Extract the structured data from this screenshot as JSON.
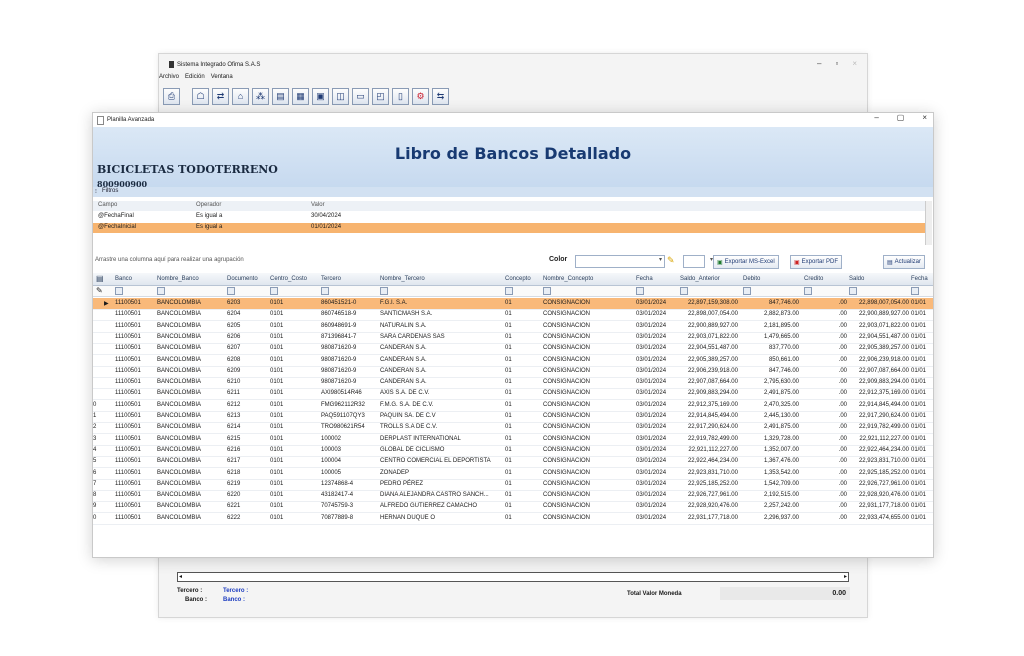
{
  "bg_window": {
    "title": "Sistema Integrado Ofima S.A.S",
    "menu": [
      "Archivo",
      "Edición",
      "Ventana"
    ],
    "tercero_label": "Tercero :",
    "tercero_value": "Tercero :",
    "banco_label": "Banco :",
    "banco_value": "Banco :",
    "total_label": "Total Valor Moneda",
    "total_value": "0.00"
  },
  "main": {
    "window_title": "Planilla Avanzada",
    "report_title": "Libro de Bancos Detallado",
    "company": "BICICLETAS TODOTERRENO",
    "nit": "800900900",
    "filters_label": "Filtros",
    "filter_headers": {
      "campo": "Campo",
      "operador": "Operador",
      "valor": "Valor"
    },
    "filters": [
      {
        "campo": "@FechaFinal",
        "operador": "Es igual a",
        "valor": "30/04/2024"
      },
      {
        "campo": "@FechaInicial",
        "operador": "Es igual a",
        "valor": "01/01/2024"
      }
    ],
    "group_hint": "Arrastre una columna aquí para realizar una agrupación",
    "color_label": "Color",
    "export_excel": "Exportar MS-Excel",
    "export_pdf": "Exportar PDF",
    "refresh": "Actualizar"
  },
  "table": {
    "columns": [
      "Banco",
      "Nombre_Banco",
      "Documento",
      "Centro_Costo",
      "Tercero",
      "Nombre_Tercero",
      "Concepto",
      "Nombre_Concepto",
      "Fecha",
      "Saldo_Anterior",
      "Debito",
      "Credito",
      "Saldo",
      "Fecha"
    ],
    "rows": [
      {
        "n": "",
        "banco": "11100501",
        "nb": "BANCOLOMBIA",
        "doc": "6203",
        "cc": "0101",
        "ter": "860451521-0",
        "nt": "F.G.I. S.A.",
        "con": "01",
        "nc": "CONSIGNACION",
        "fecha": "03/01/2024",
        "sa": "22,897,159,308.00",
        "deb": "847,746.00",
        "cre": ".00",
        "saldo": "22,898,007,054.00",
        "f2": "01/01"
      },
      {
        "n": "",
        "banco": "11100501",
        "nb": "BANCOLOMBIA",
        "doc": "6204",
        "cc": "0101",
        "ter": "860746518-9",
        "nt": "SANTICMASH S.A.",
        "con": "01",
        "nc": "CONSIGNACION",
        "fecha": "03/01/2024",
        "sa": "22,898,007,054.00",
        "deb": "2,882,873.00",
        "cre": ".00",
        "saldo": "22,900,889,927.00",
        "f2": "01/01"
      },
      {
        "n": "",
        "banco": "11100501",
        "nb": "BANCOLOMBIA",
        "doc": "6205",
        "cc": "0101",
        "ter": "860948691-9",
        "nt": "NATURALIN S.A.",
        "con": "01",
        "nc": "CONSIGNACION",
        "fecha": "03/01/2024",
        "sa": "22,900,889,927.00",
        "deb": "2,181,895.00",
        "cre": ".00",
        "saldo": "22,903,071,822.00",
        "f2": "01/01"
      },
      {
        "n": "",
        "banco": "11100501",
        "nb": "BANCOLOMBIA",
        "doc": "6206",
        "cc": "0101",
        "ter": "871396841-7",
        "nt": "SARA CARDENAS SAS",
        "con": "01",
        "nc": "CONSIGNACION",
        "fecha": "03/01/2024",
        "sa": "22,903,071,822.00",
        "deb": "1,479,665.00",
        "cre": ".00",
        "saldo": "22,904,551,487.00",
        "f2": "01/01"
      },
      {
        "n": "",
        "banco": "11100501",
        "nb": "BANCOLOMBIA",
        "doc": "6207",
        "cc": "0101",
        "ter": "980871620-9",
        "nt": "CANDERAN S.A.",
        "con": "01",
        "nc": "CONSIGNACION",
        "fecha": "03/01/2024",
        "sa": "22,904,551,487.00",
        "deb": "837,770.00",
        "cre": ".00",
        "saldo": "22,905,389,257.00",
        "f2": "01/01"
      },
      {
        "n": "",
        "banco": "11100501",
        "nb": "BANCOLOMBIA",
        "doc": "6208",
        "cc": "0101",
        "ter": "980871620-9",
        "nt": "CANDERAN S.A.",
        "con": "01",
        "nc": "CONSIGNACION",
        "fecha": "03/01/2024",
        "sa": "22,905,389,257.00",
        "deb": "850,661.00",
        "cre": ".00",
        "saldo": "22,906,239,918.00",
        "f2": "01/01"
      },
      {
        "n": "",
        "banco": "11100501",
        "nb": "BANCOLOMBIA",
        "doc": "6209",
        "cc": "0101",
        "ter": "980871620-9",
        "nt": "CANDERAN S.A.",
        "con": "01",
        "nc": "CONSIGNACION",
        "fecha": "03/01/2024",
        "sa": "22,906,239,918.00",
        "deb": "847,746.00",
        "cre": ".00",
        "saldo": "22,907,087,664.00",
        "f2": "01/01"
      },
      {
        "n": "",
        "banco": "11100501",
        "nb": "BANCOLOMBIA",
        "doc": "6210",
        "cc": "0101",
        "ter": "980871620-9",
        "nt": "CANDERAN S.A.",
        "con": "01",
        "nc": "CONSIGNACION",
        "fecha": "03/01/2024",
        "sa": "22,907,087,664.00",
        "deb": "2,795,630.00",
        "cre": ".00",
        "saldo": "22,909,883,294.00",
        "f2": "01/01"
      },
      {
        "n": "",
        "banco": "11100501",
        "nb": "BANCOLOMBIA",
        "doc": "6211",
        "cc": "0101",
        "ter": "AXI980514R46",
        "nt": "AXIS S.A. DE C.V.",
        "con": "01",
        "nc": "CONSIGNACION",
        "fecha": "03/01/2024",
        "sa": "22,909,883,294.00",
        "deb": "2,491,875.00",
        "cre": ".00",
        "saldo": "22,912,375,169.00",
        "f2": "01/01"
      },
      {
        "n": "0",
        "banco": "11100501",
        "nb": "BANCOLOMBIA",
        "doc": "6212",
        "cc": "0101",
        "ter": "FMG962112R32",
        "nt": "F.M.G. S.A. DE C.V.",
        "con": "01",
        "nc": "CONSIGNACION",
        "fecha": "03/01/2024",
        "sa": "22,912,375,169.00",
        "deb": "2,470,325.00",
        "cre": ".00",
        "saldo": "22,914,845,494.00",
        "f2": "01/01"
      },
      {
        "n": "1",
        "banco": "11100501",
        "nb": "BANCOLOMBIA",
        "doc": "6213",
        "cc": "0101",
        "ter": "PAQ591107QY3",
        "nt": "PAQUIN SA. DE C.V",
        "con": "01",
        "nc": "CONSIGNACION",
        "fecha": "03/01/2024",
        "sa": "22,914,845,494.00",
        "deb": "2,445,130.00",
        "cre": ".00",
        "saldo": "22,917,290,624.00",
        "f2": "01/01"
      },
      {
        "n": "2",
        "banco": "11100501",
        "nb": "BANCOLOMBIA",
        "doc": "6214",
        "cc": "0101",
        "ter": "TRO980621R54",
        "nt": "TROLLS S.A DE C.V.",
        "con": "01",
        "nc": "CONSIGNACION",
        "fecha": "03/01/2024",
        "sa": "22,917,290,624.00",
        "deb": "2,491,875.00",
        "cre": ".00",
        "saldo": "22,919,782,499.00",
        "f2": "01/01"
      },
      {
        "n": "3",
        "banco": "11100501",
        "nb": "BANCOLOMBIA",
        "doc": "6215",
        "cc": "0101",
        "ter": "100002",
        "nt": "DERPLAST INTERNATIONAL",
        "con": "01",
        "nc": "CONSIGNACION",
        "fecha": "03/01/2024",
        "sa": "22,919,782,499.00",
        "deb": "1,329,728.00",
        "cre": ".00",
        "saldo": "22,921,112,227.00",
        "f2": "01/01"
      },
      {
        "n": "4",
        "banco": "11100501",
        "nb": "BANCOLOMBIA",
        "doc": "6216",
        "cc": "0101",
        "ter": "100003",
        "nt": "GLOBAL DE CICLISMO",
        "con": "01",
        "nc": "CONSIGNACION",
        "fecha": "03/01/2024",
        "sa": "22,921,112,227.00",
        "deb": "1,352,007.00",
        "cre": ".00",
        "saldo": "22,922,464,234.00",
        "f2": "01/01"
      },
      {
        "n": "5",
        "banco": "11100501",
        "nb": "BANCOLOMBIA",
        "doc": "6217",
        "cc": "0101",
        "ter": "100004",
        "nt": "CENTRO COMERCIAL EL DEPORTISTA",
        "con": "01",
        "nc": "CONSIGNACION",
        "fecha": "03/01/2024",
        "sa": "22,922,464,234.00",
        "deb": "1,367,476.00",
        "cre": ".00",
        "saldo": "22,923,831,710.00",
        "f2": "01/01"
      },
      {
        "n": "6",
        "banco": "11100501",
        "nb": "BANCOLOMBIA",
        "doc": "6218",
        "cc": "0101",
        "ter": "100005",
        "nt": "ZONADEP",
        "con": "01",
        "nc": "CONSIGNACION",
        "fecha": "03/01/2024",
        "sa": "22,923,831,710.00",
        "deb": "1,353,542.00",
        "cre": ".00",
        "saldo": "22,925,185,252.00",
        "f2": "01/01"
      },
      {
        "n": "7",
        "banco": "11100501",
        "nb": "BANCOLOMBIA",
        "doc": "6219",
        "cc": "0101",
        "ter": "12374868-4",
        "nt": "PEDRO PÉREZ",
        "con": "01",
        "nc": "CONSIGNACION",
        "fecha": "03/01/2024",
        "sa": "22,925,185,252.00",
        "deb": "1,542,709.00",
        "cre": ".00",
        "saldo": "22,926,727,961.00",
        "f2": "01/01"
      },
      {
        "n": "8",
        "banco": "11100501",
        "nb": "BANCOLOMBIA",
        "doc": "6220",
        "cc": "0101",
        "ter": "43182417-4",
        "nt": "DIANA ALEJANDRA CASTRO SANCH...",
        "con": "01",
        "nc": "CONSIGNACION",
        "fecha": "03/01/2024",
        "sa": "22,926,727,961.00",
        "deb": "2,192,515.00",
        "cre": ".00",
        "saldo": "22,928,920,476.00",
        "f2": "01/01"
      },
      {
        "n": "9",
        "banco": "11100501",
        "nb": "BANCOLOMBIA",
        "doc": "6221",
        "cc": "0101",
        "ter": "70745759-3",
        "nt": "ALFREDO GUTIERREZ CAMACHO",
        "con": "01",
        "nc": "CONSIGNACION",
        "fecha": "03/01/2024",
        "sa": "22,928,920,476.00",
        "deb": "2,257,242.00",
        "cre": ".00",
        "saldo": "22,931,177,718.00",
        "f2": "01/01"
      },
      {
        "n": "0",
        "banco": "11100501",
        "nb": "BANCOLOMBIA",
        "doc": "6222",
        "cc": "0101",
        "ter": "70877889-8",
        "nt": "HERNAN DUQUE O",
        "con": "01",
        "nc": "CONSIGNACION",
        "fecha": "03/01/2024",
        "sa": "22,931,177,718.00",
        "deb": "2,296,937.00",
        "cre": ".00",
        "saldo": "22,933,474,655.00",
        "f2": "01/01"
      }
    ]
  },
  "colors": {
    "selected_row": "#f9b97a",
    "banner": "#c3d7ee",
    "title": "#183a72"
  }
}
